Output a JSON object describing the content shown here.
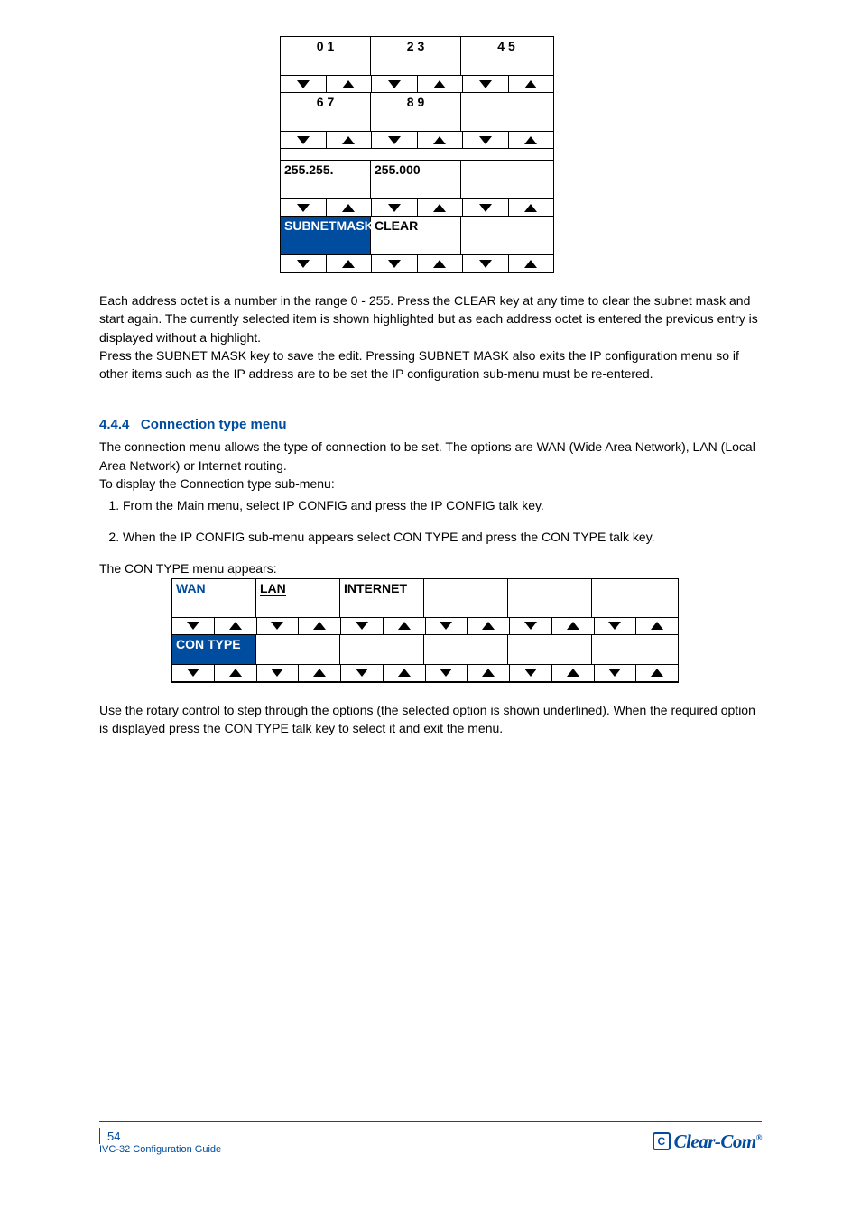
{
  "panel1": {
    "rows": [
      {
        "cells": [
          "0   1",
          "2   3",
          "4   5"
        ]
      },
      {
        "arrows": 3
      },
      {
        "cells": [
          "6   7",
          "8   9",
          ""
        ]
      },
      {
        "arrows": 3
      },
      {
        "spacer": 3
      },
      {
        "cells": [
          "255.255.",
          "255.000",
          ""
        ]
      },
      {
        "arrows": 3
      },
      {
        "cells_hl": [
          {
            "t": "SUBNETMASK",
            "hl": true
          },
          {
            "t": "CLEAR",
            "hl": false
          },
          {
            "t": "",
            "hl": false
          }
        ]
      },
      {
        "arrows": 3
      }
    ]
  },
  "para1": "Each address octet is a number in the range 0 - 255.  Press the CLEAR key at any time to clear the subnet mask and start again. The currently selected item is shown highlighted but as each address octet is entered the previous entry is displayed without a highlight.",
  "para2": "Press the SUBNET MASK key to save the edit.  Pressing SUBNET MASK also exits the IP configuration menu so if other items such as the IP address are to be set the IP configuration sub-menu must be re-entered.",
  "sect_num": "4.4.4",
  "sect_title": "Connection type menu",
  "para3": "The connection menu allows the type of connection to be set.  The options are WAN (Wide Area Network), LAN (Local Area Network) or Internet routing.",
  "para4": "To display the Connection type sub-menu:",
  "steps": [
    "From the Main menu, select IP CONFIG and press the IP CONFIG talk key.",
    "When the IP CONFIG sub-menu appears select CON TYPE and press the CON TYPE talk key."
  ],
  "para5": "The CON TYPE menu appears:",
  "panel2": {
    "labels": [
      "WAN",
      "LAN",
      "INTERNET",
      "",
      "",
      ""
    ],
    "lan_under": true,
    "rows": [
      {
        "arrows": 6
      },
      {
        "cells_hl": [
          {
            "t": "CON TYPE",
            "hl": true
          },
          {
            "t": "",
            "hl": false
          },
          {
            "t": "",
            "hl": false
          },
          {
            "t": "",
            "hl": false
          },
          {
            "t": "",
            "hl": false
          },
          {
            "t": "",
            "hl": false
          }
        ]
      },
      {
        "arrows": 6
      }
    ]
  },
  "para6": "Use the rotary control to step through the options (the selected option is shown underlined). When the required option is displayed press the CON TYPE talk key to select it and exit the menu.",
  "page_no": "54",
  "doclabel": "IVC-32 Configuration Guide",
  "logo_text": "Clear-Com",
  "logo_reg": "®"
}
